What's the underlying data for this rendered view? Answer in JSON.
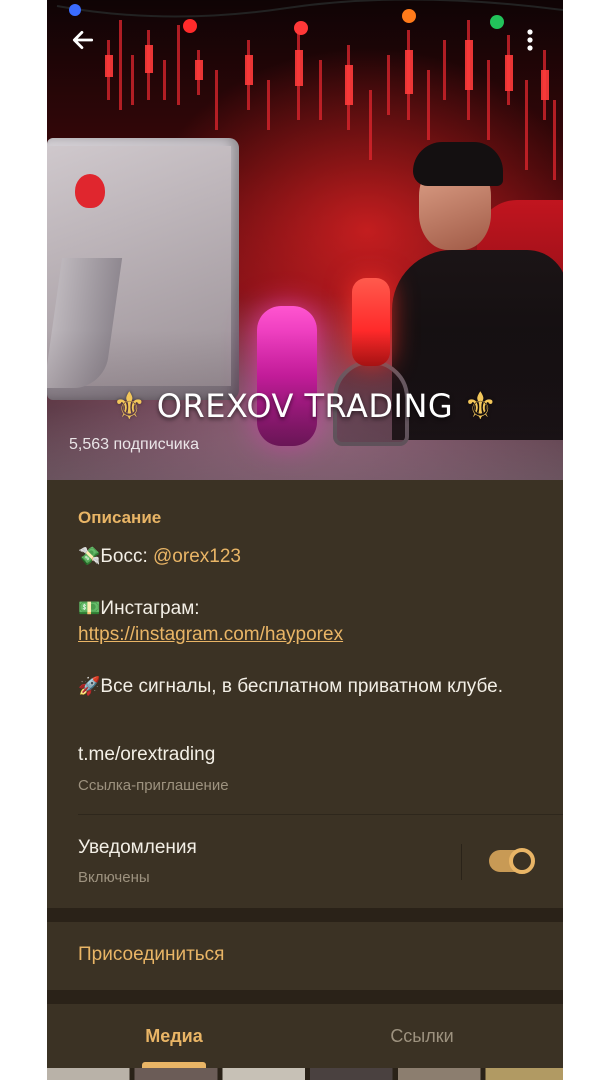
{
  "header": {
    "title": "OREXOV TRADING",
    "subtitle": "5,563 подписчика",
    "back_icon": "arrow-left-icon",
    "menu_icon": "more-vertical-icon"
  },
  "info": {
    "section_title": "Описание",
    "description": {
      "line1_emoji": "💸",
      "line1_prefix": "Босс: ",
      "line1_link": "@orex123",
      "line2_emoji": "💵",
      "line2_text": "Инстаграм:",
      "line2_url": "https://instagram.com/hayporex",
      "line3_emoji": "🚀",
      "line3_text": "Все сигналы, в бесплатном приватном клубе."
    },
    "invite_link": "t.me/orextrading",
    "invite_caption": "Ссылка-приглашение",
    "notifications_title": "Уведомления",
    "notifications_state": "Включены",
    "notifications_enabled": true
  },
  "actions": {
    "join": "Присоединиться"
  },
  "tabs": [
    {
      "label": "Медиа",
      "active": true
    },
    {
      "label": "Ссылки",
      "active": false
    }
  ],
  "colors": {
    "accent": "#e9b566",
    "background": "#3b3224",
    "text": "#f3efe6",
    "secondary_text": "#9d927f"
  }
}
